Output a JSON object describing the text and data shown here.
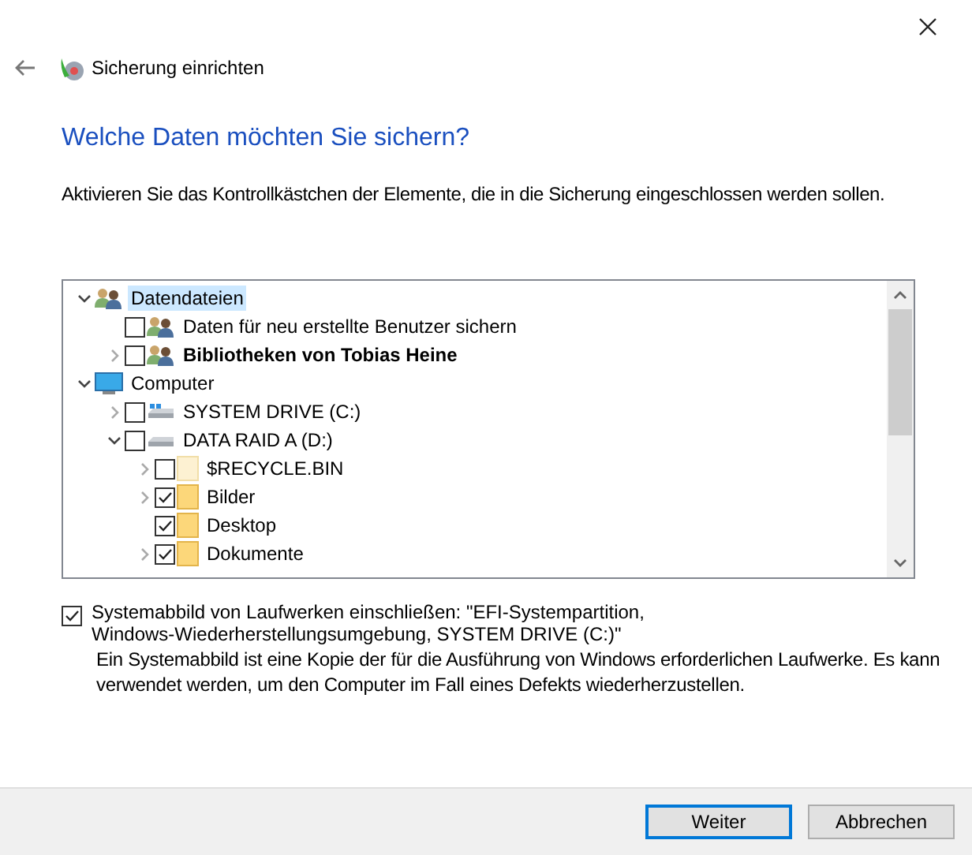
{
  "window": {
    "title": "Sicherung einrichten"
  },
  "heading": "Welche Daten möchten Sie sichern?",
  "instruction": "Aktivieren Sie das Kontrollkästchen der Elemente, die in die Sicherung eingeschlossen werden sollen.",
  "tree": [
    {
      "label": "Datendateien",
      "kind": "users",
      "expanded": true,
      "selected": true,
      "children": [
        {
          "label": "Daten für neu erstellte Benutzer sichern",
          "kind": "users",
          "checked": false,
          "selected": false
        },
        {
          "label": "Bibliotheken von Tobias Heine",
          "kind": "users",
          "checked": false,
          "expanded": false,
          "bold": true,
          "selected": false
        }
      ]
    },
    {
      "label": "Computer",
      "kind": "computer",
      "expanded": true,
      "selected": false,
      "children": [
        {
          "label": "SYSTEM DRIVE (C:)",
          "kind": "systemdrive",
          "checked": false,
          "expanded": false,
          "selected": false
        },
        {
          "label": "DATA RAID A (D:)",
          "kind": "drive",
          "checked": false,
          "expanded": true,
          "selected": false,
          "children": [
            {
              "label": "$RECYCLE.BIN",
              "kind": "hiddenfolder",
              "checked": false,
              "expanded": false,
              "selected": false
            },
            {
              "label": "Bilder",
              "kind": "folder",
              "checked": true,
              "expanded": false,
              "selected": false
            },
            {
              "label": "Desktop",
              "kind": "folder",
              "checked": true,
              "selected": false
            },
            {
              "label": "Dokumente",
              "kind": "folder",
              "checked": true,
              "expanded": false,
              "selected": false
            }
          ]
        }
      ]
    }
  ],
  "system_image": {
    "checked": true,
    "label": "Systemabbild von Laufwerken einschließen: \"EFI-Systempartition, Windows-Wiederherstellungsumgebung, SYSTEM DRIVE (C:)\"",
    "description": "Ein Systemabbild ist eine Kopie der für die Ausführung von Windows erforderlichen Laufwerke. Es kann verwendet werden, um den Computer im Fall eines Defekts wiederherzustellen."
  },
  "buttons": [
    {
      "label": "Weiter",
      "default": true
    },
    {
      "label": "Abbrechen",
      "default": false
    }
  ]
}
